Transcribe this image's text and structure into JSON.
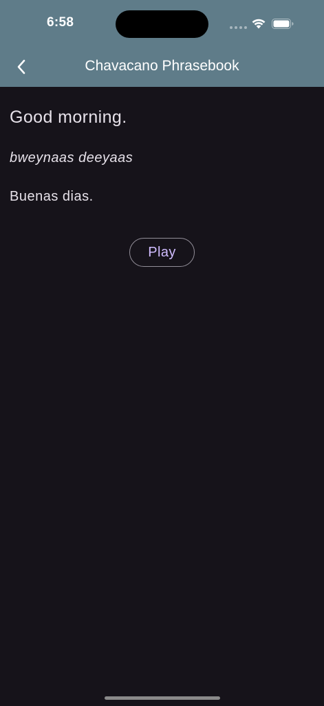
{
  "status_bar": {
    "time": "6:58",
    "icons": [
      "signal-dots-icon",
      "wifi-icon",
      "battery-icon"
    ]
  },
  "nav": {
    "back_icon": "chevron-left-icon",
    "title": "Chavacano Phrasebook"
  },
  "phrase": {
    "english": "Good morning.",
    "pronunciation": "bweynaas deeyaas",
    "translation": "Buenas dias."
  },
  "actions": {
    "play_label": "Play"
  },
  "colors": {
    "header_bg": "#5f7c89",
    "page_bg": "#16131a",
    "text": "#e6e1e9",
    "accent": "#d0bcff",
    "outline": "#938f99"
  }
}
